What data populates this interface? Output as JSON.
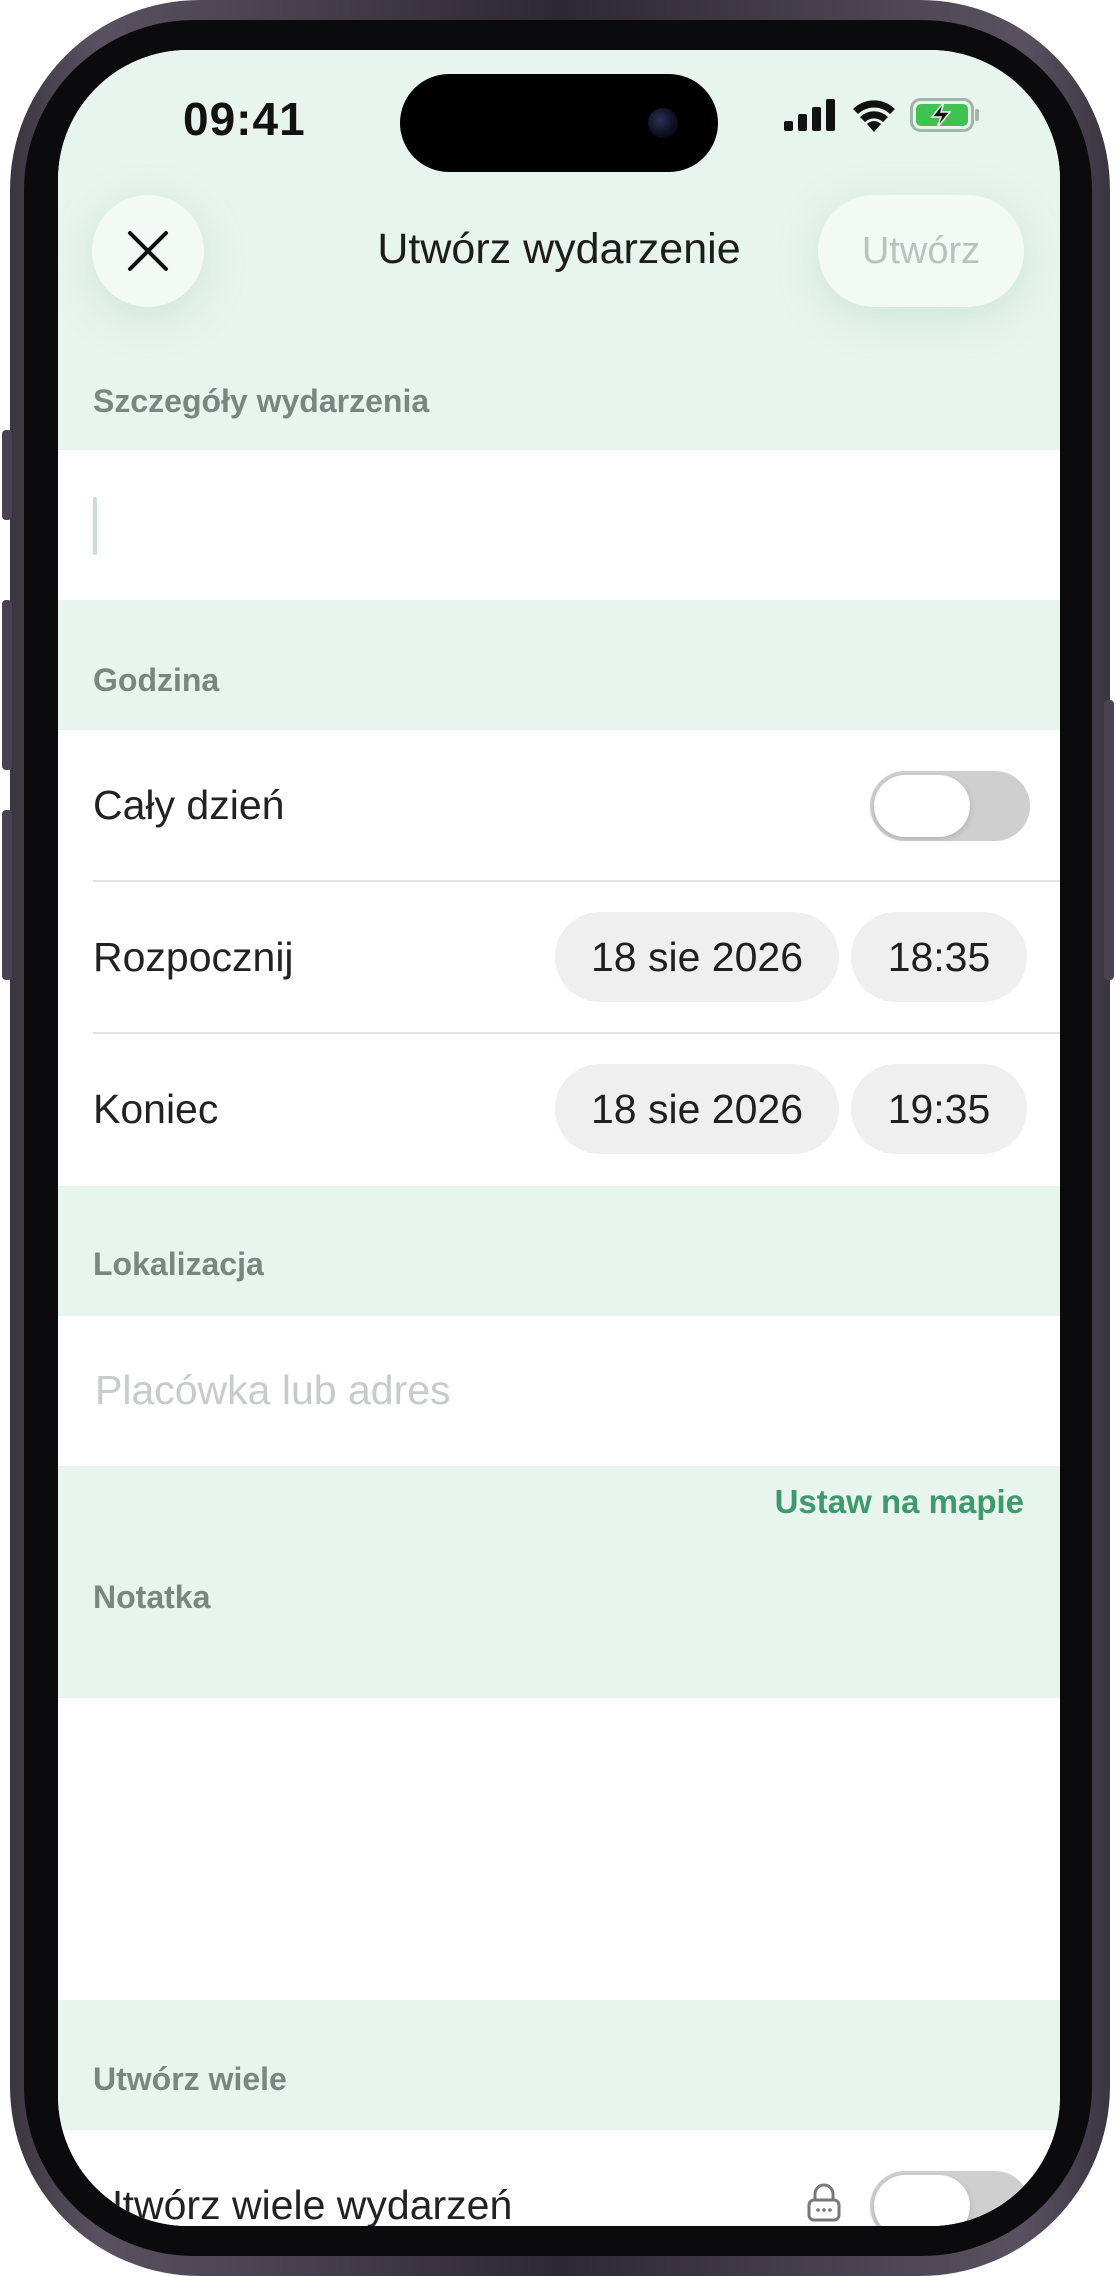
{
  "status_bar": {
    "time": "09:41",
    "icons": [
      "cellular-signal-icon",
      "wifi-icon",
      "battery-charging-icon"
    ]
  },
  "header": {
    "title": "Utwórz wydarzenie",
    "close_icon": "close-icon",
    "create_label": "Utwórz"
  },
  "sections": {
    "details": {
      "label": "Szczegóły wydarzenia",
      "title_value": ""
    },
    "time": {
      "label": "Godzina",
      "all_day_label": "Cały dzień",
      "all_day_on": false,
      "start_label": "Rozpocznij",
      "start_date": "18 sie 2026",
      "start_time": "18:35",
      "end_label": "Koniec",
      "end_date": "18 sie 2026",
      "end_time": "19:35"
    },
    "location": {
      "label": "Lokalizacja",
      "placeholder": "Placówka lub adres",
      "map_link": "Ustaw na mapie"
    },
    "note": {
      "label": "Notatka",
      "value": ""
    },
    "multiple": {
      "label": "Utwórz wiele",
      "row_label": "Utwórz wiele wydarzeń",
      "lock_icon": "lock-icon",
      "enabled": false
    }
  },
  "colors": {
    "section_bg": "#e8f4ee",
    "accent_green": "#3e9a6c",
    "disabled_text": "#b9c2bd"
  }
}
